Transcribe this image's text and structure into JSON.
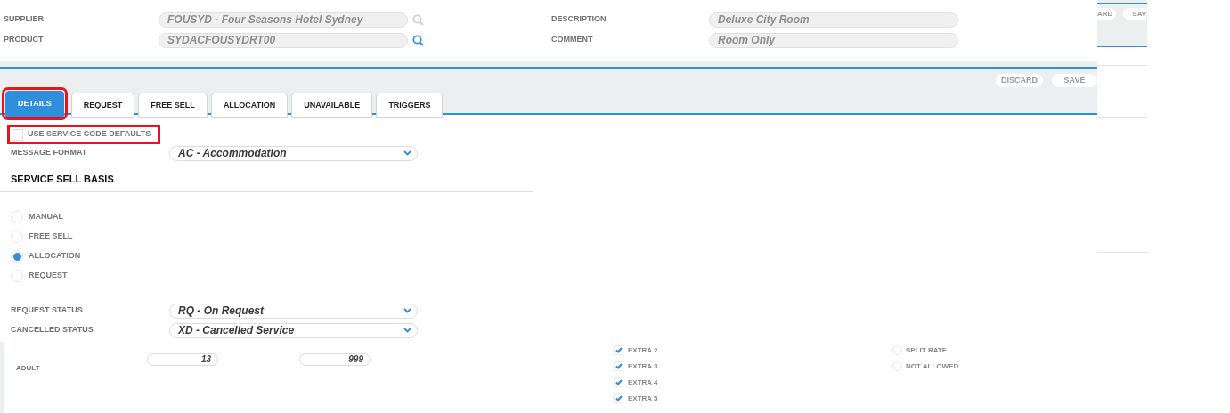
{
  "header": {
    "fields": [
      {
        "label": "SUPPLIER",
        "value": "FOUSYD - Four Seasons Hotel Sydney",
        "search_enabled": false
      },
      {
        "label": "PRODUCT",
        "value": "SYDACFOUSYDRT00",
        "search_enabled": true
      }
    ],
    "side_fields": [
      {
        "label": "DESCRIPTION",
        "value": "Deluxe City Room"
      },
      {
        "label": "COMMENT",
        "value": "Room Only"
      }
    ]
  },
  "toolbar": {
    "actions": [
      "DISCARD",
      "SAVE"
    ],
    "behind_actions": [
      "ARD",
      "SAV"
    ]
  },
  "tabs": [
    {
      "label": "DETAILS",
      "selected": true,
      "highlighted": true
    },
    {
      "label": "REQUEST",
      "selected": false,
      "highlighted": false
    },
    {
      "label": "FREE SELL",
      "selected": false,
      "highlighted": false
    },
    {
      "label": "ALLOCATION",
      "selected": false,
      "highlighted": false
    },
    {
      "label": "UNAVAILABLE",
      "selected": false,
      "highlighted": false
    },
    {
      "label": "TRIGGERS",
      "selected": false,
      "highlighted": false
    }
  ],
  "details": {
    "defaults": {
      "label": "USE SERVICE CODE DEFAULTS",
      "checked": false,
      "highlighted": true
    },
    "message_format": {
      "label": "MESSAGE FORMAT",
      "value": "AC - Accommodation"
    },
    "section_title": "SERVICE SELL BASIS",
    "sell_basis": [
      {
        "label": "MANUAL",
        "selected": false
      },
      {
        "label": "FREE SELL",
        "selected": false
      },
      {
        "label": "ALLOCATION",
        "selected": true
      },
      {
        "label": "REQUEST",
        "selected": false
      }
    ],
    "statuses": [
      {
        "label": "REQUEST STATUS",
        "value": "RQ - On Request"
      },
      {
        "label": "CANCELLED STATUS",
        "value": "XD - Cancelled Service"
      }
    ]
  },
  "behind": {
    "adult": {
      "label": "ADULT",
      "values": [
        "13",
        "999"
      ]
    },
    "extras": [
      {
        "label": "EXTRA 2",
        "checked": true
      },
      {
        "label": "EXTRA 3",
        "checked": true
      },
      {
        "label": "EXTRA 4",
        "checked": true
      },
      {
        "label": "EXTRA 5",
        "checked": true
      }
    ],
    "options": [
      {
        "label": "SPLIT RATE",
        "selected": false
      },
      {
        "label": "NOT ALLOWED",
        "selected": false
      }
    ]
  }
}
